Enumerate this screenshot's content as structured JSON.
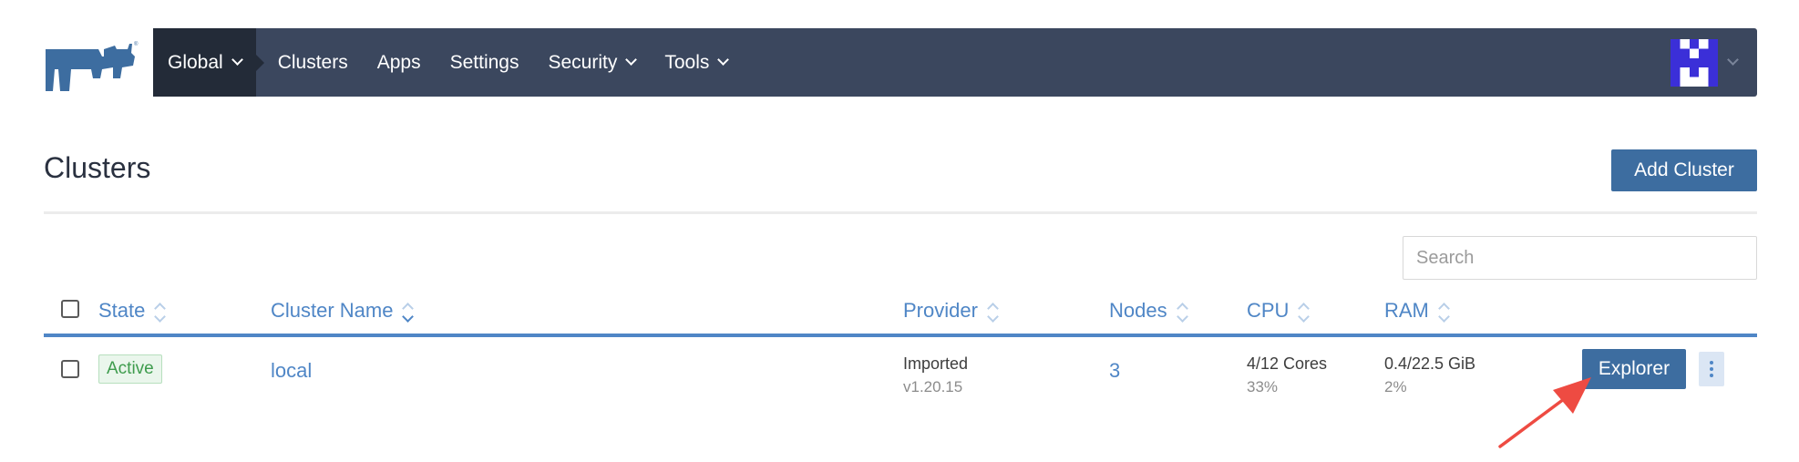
{
  "header": {
    "nav_items": [
      {
        "label": "Global",
        "has_dropdown": true,
        "active": true
      },
      {
        "label": "Clusters",
        "has_dropdown": false
      },
      {
        "label": "Apps",
        "has_dropdown": false
      },
      {
        "label": "Settings",
        "has_dropdown": false
      },
      {
        "label": "Security",
        "has_dropdown": true
      },
      {
        "label": "Tools",
        "has_dropdown": true
      }
    ],
    "logo_icon": "rancher-cow-logo",
    "avatar_icon": "identicon-avatar",
    "colors": {
      "navbar_bg": "#3b475e",
      "active_bg": "#232b38",
      "logo": "#3d6da0",
      "avatar": "#3b2fd8"
    }
  },
  "page": {
    "title": "Clusters",
    "add_button_label": "Add Cluster",
    "search_placeholder": "Search"
  },
  "table": {
    "columns": [
      "State",
      "Cluster Name",
      "Provider",
      "Nodes",
      "CPU",
      "RAM"
    ],
    "sorted_column": "Cluster Name",
    "rows": [
      {
        "state": "Active",
        "name": "local",
        "provider": "Imported",
        "provider_version": "v1.20.15",
        "nodes": "3",
        "cpu": "4/12 Cores",
        "cpu_percent": "33%",
        "ram": "0.4/22.5 GiB",
        "ram_percent": "2%",
        "action_label": "Explorer"
      }
    ],
    "colors": {
      "link": "#4f86c6",
      "accent_rule": "#4f86c6",
      "primary_button": "#3d6da0",
      "active_badge": "#3e9c4d"
    }
  },
  "annotation": {
    "arrow_icon": "red-arrow",
    "color": "#ee4b42"
  }
}
